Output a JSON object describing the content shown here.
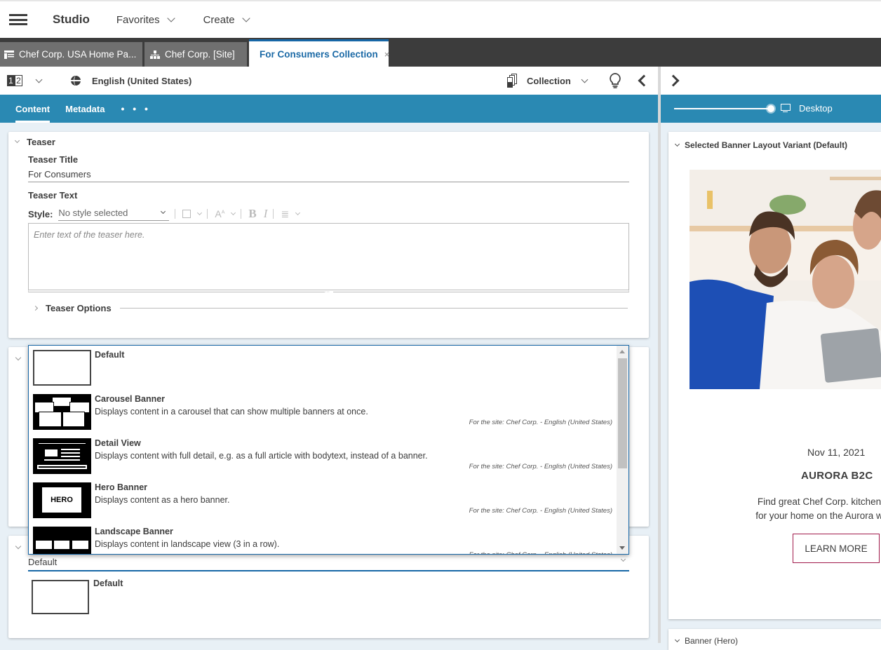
{
  "header": {
    "menu_icon": "hamburger-icon",
    "app_title": "Studio",
    "menus": [
      {
        "label": "Favorites"
      },
      {
        "label": "Create"
      }
    ]
  },
  "tabs": [
    {
      "label": "Chef Corp. USA Home Pa...",
      "icon": "page-icon",
      "active": false
    },
    {
      "label": "Chef Corp. [Site]",
      "icon": "sitemap-icon",
      "active": false
    },
    {
      "label": "For Consumers Collection",
      "icon": "collection-icon",
      "active": true,
      "close": "×"
    }
  ],
  "toolbar": {
    "version_label": [
      "1",
      "2"
    ],
    "language": "English (United States)",
    "doc_type": "Collection"
  },
  "subtabs": {
    "items": [
      {
        "label": "Content",
        "active": true
      },
      {
        "label": "Metadata",
        "active": false
      }
    ],
    "more": "• • •"
  },
  "preview_bar": {
    "device": "Desktop",
    "zoom_fraction": 1.0
  },
  "teaser": {
    "section_title": "Teaser",
    "title_label": "Teaser Title",
    "title_value": "For Consumers",
    "text_label": "Teaser Text",
    "style_label": "Style:",
    "style_value": "No style selected",
    "editor_placeholder": "Enter text of the teaser here.",
    "options_label": "Teaser Options"
  },
  "layout_dropdown": {
    "options": [
      {
        "title": "Default",
        "description": "",
        "site": "",
        "thumb": "default"
      },
      {
        "title": "Carousel Banner",
        "description": "Displays content in a carousel that can show multiple banners at once.",
        "site": "For the site: Chef Corp. - English (United States)",
        "thumb": "carousel"
      },
      {
        "title": "Detail View",
        "description": "Displays content with full detail, e.g. as a full article with bodytext, instead of a banner.",
        "site": "For the site: Chef Corp. - English (United States)",
        "thumb": "detail"
      },
      {
        "title": "Hero Banner",
        "description": "Displays content as a hero banner.",
        "site": "For the site: Chef Corp. - English (United States)",
        "thumb": "hero",
        "thumb_text": "HERO"
      },
      {
        "title": "Landscape Banner",
        "description": "Displays content in landscape view (3 in a row).",
        "site": "For the site: Chef Corp. - English (United States)",
        "thumb": "landscape"
      }
    ],
    "selected_value": "Default",
    "selected_preview_title": "Default"
  },
  "preview": {
    "card_title": "Selected Banner Layout Variant (Default)",
    "date": "Nov 11, 2021",
    "headline": "AURORA B2C",
    "description_lines": [
      "Find great Chef Corp. kitchen",
      "for your home on the Aurora w"
    ],
    "cta": "LEARN MORE",
    "next_card_title": "Banner (Hero)",
    "accent_color": "#a0194a"
  },
  "colors": {
    "primary": "#1767a7",
    "subtab_bg": "#2a89b3",
    "tabbar_bg": "#3c3c3c"
  }
}
